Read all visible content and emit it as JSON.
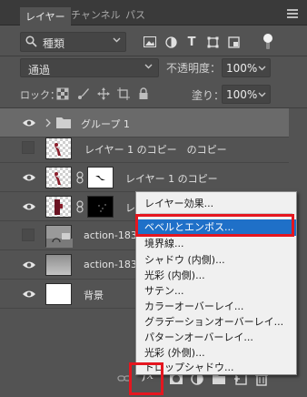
{
  "tabs": [
    {
      "label": "レイヤー",
      "active": true
    },
    {
      "label": "チャンネル",
      "active": false
    },
    {
      "label": "パス",
      "active": false
    }
  ],
  "filter": {
    "label": "種類"
  },
  "blend_mode": {
    "label": "通過"
  },
  "opacity": {
    "label": "不透明度：",
    "value": "100%"
  },
  "lock": {
    "label": "ロック："
  },
  "fill": {
    "label": "塗り：",
    "value": "100%"
  },
  "layers": [
    {
      "name": "グループ 1",
      "visible": true
    },
    {
      "name": "レイヤー 1 のコピー　のコピー",
      "visible": false
    },
    {
      "name": "レイヤー 1 のコピー",
      "visible": true
    },
    {
      "name": "レ",
      "visible": true
    },
    {
      "name": "action-1838",
      "visible": false
    },
    {
      "name": "action-1838",
      "visible": true
    },
    {
      "name": "背景",
      "visible": true
    }
  ],
  "context_menu": {
    "items": [
      {
        "label": "レイヤー効果...",
        "selected": false
      },
      {
        "label": "ベベルとエンボス...",
        "selected": true
      },
      {
        "label": "境界線...",
        "selected": false
      },
      {
        "label": "シャドウ (内側)...",
        "selected": false
      },
      {
        "label": "光彩 (内側)...",
        "selected": false
      },
      {
        "label": "サテン...",
        "selected": false
      },
      {
        "label": "カラーオーバーレイ...",
        "selected": false
      },
      {
        "label": "グラデーションオーバーレイ...",
        "selected": false
      },
      {
        "label": "パターンオーバーレイ...",
        "selected": false
      },
      {
        "label": "光彩 (外側)...",
        "selected": false
      },
      {
        "label": "ドロップシャドウ...",
        "selected": false
      }
    ]
  },
  "bottom_toolbar": {
    "fx_label": "fx"
  },
  "colors": {
    "selection": "#1f70c8",
    "highlight": "#e5161f",
    "panel": "#535353"
  },
  "filter_icons": {
    "type": "T"
  }
}
